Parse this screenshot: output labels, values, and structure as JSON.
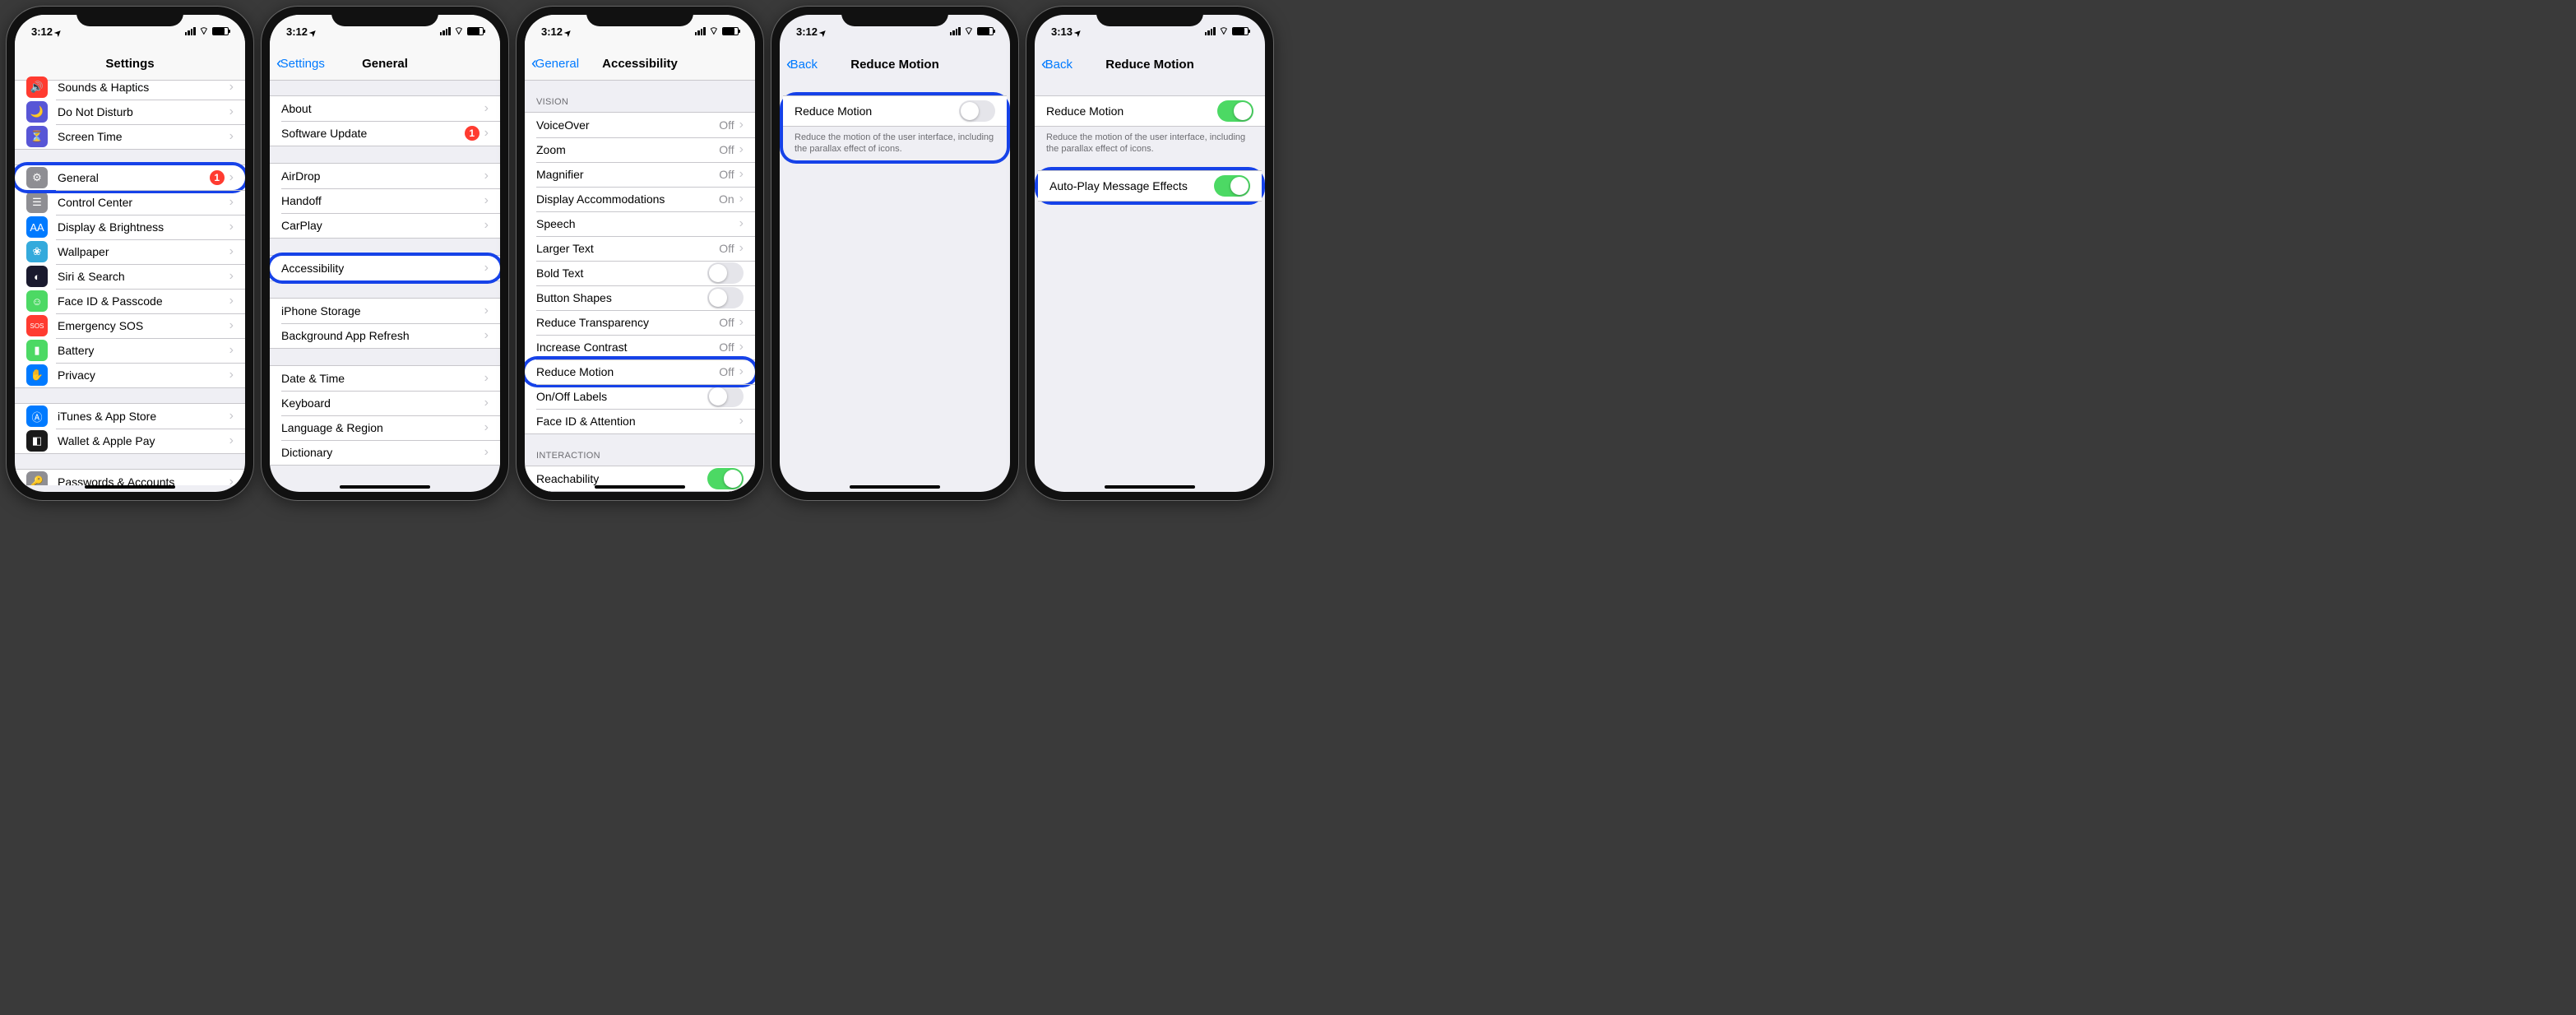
{
  "screens": [
    {
      "time": "3:12",
      "title": "Settings",
      "back": null,
      "groups": [
        {
          "items": [
            {
              "icon_bg": "#ff3b30",
              "icon": "🔊",
              "label": "Sounds & Haptics"
            },
            {
              "icon_bg": "#5856d6",
              "icon": "🌙",
              "label": "Do Not Disturb"
            },
            {
              "icon_bg": "#5856d6",
              "icon": "⏳",
              "label": "Screen Time"
            }
          ]
        },
        {
          "items": [
            {
              "icon_bg": "#8e8e93",
              "icon": "⚙",
              "label": "General",
              "badge": "1",
              "highlight": true
            },
            {
              "icon_bg": "#8e8e93",
              "icon": "☰",
              "label": "Control Center"
            },
            {
              "icon_bg": "#007aff",
              "icon": "AA",
              "label": "Display & Brightness"
            },
            {
              "icon_bg": "#34aadc",
              "icon": "❀",
              "label": "Wallpaper"
            },
            {
              "icon_bg": "#1a1a2e",
              "icon": "◐",
              "label": "Siri & Search"
            },
            {
              "icon_bg": "#4cd964",
              "icon": "☺",
              "label": "Face ID & Passcode"
            },
            {
              "icon_bg": "#ff3b30",
              "icon": "SOS",
              "label": "Emergency SOS"
            },
            {
              "icon_bg": "#4cd964",
              "icon": "▮",
              "label": "Battery"
            },
            {
              "icon_bg": "#007aff",
              "icon": "✋",
              "label": "Privacy"
            }
          ]
        },
        {
          "items": [
            {
              "icon_bg": "#007aff",
              "icon": "Ⓐ",
              "label": "iTunes & App Store"
            },
            {
              "icon_bg": "#1a1a1a",
              "icon": "◧",
              "label": "Wallet & Apple Pay"
            }
          ]
        },
        {
          "items": [
            {
              "icon_bg": "#8e8e93",
              "icon": "🔑",
              "label": "Passwords & Accounts"
            }
          ]
        }
      ]
    },
    {
      "time": "3:12",
      "title": "General",
      "back": "Settings",
      "groups": [
        {
          "items": [
            {
              "label": "About"
            },
            {
              "label": "Software Update",
              "badge": "1"
            }
          ]
        },
        {
          "items": [
            {
              "label": "AirDrop"
            },
            {
              "label": "Handoff"
            },
            {
              "label": "CarPlay"
            }
          ]
        },
        {
          "items": [
            {
              "label": "Accessibility",
              "highlight": true
            }
          ]
        },
        {
          "items": [
            {
              "label": "iPhone Storage"
            },
            {
              "label": "Background App Refresh"
            }
          ]
        },
        {
          "items": [
            {
              "label": "Date & Time"
            },
            {
              "label": "Keyboard"
            },
            {
              "label": "Language & Region"
            },
            {
              "label": "Dictionary"
            }
          ]
        }
      ]
    },
    {
      "time": "3:12",
      "title": "Accessibility",
      "back": "General",
      "sections": [
        {
          "header": "VISION",
          "items": [
            {
              "label": "VoiceOver",
              "detail": "Off"
            },
            {
              "label": "Zoom",
              "detail": "Off"
            },
            {
              "label": "Magnifier",
              "detail": "Off"
            },
            {
              "label": "Display Accommodations",
              "detail": "On"
            },
            {
              "label": "Speech"
            },
            {
              "label": "Larger Text",
              "detail": "Off"
            },
            {
              "label": "Bold Text",
              "switch": false
            },
            {
              "label": "Button Shapes",
              "switch": false
            },
            {
              "label": "Reduce Transparency",
              "detail": "Off"
            },
            {
              "label": "Increase Contrast",
              "detail": "Off"
            },
            {
              "label": "Reduce Motion",
              "detail": "Off",
              "highlight": true
            },
            {
              "label": "On/Off Labels",
              "switch": false
            },
            {
              "label": "Face ID & Attention"
            }
          ]
        },
        {
          "header": "INTERACTION",
          "items": [
            {
              "label": "Reachability",
              "switch": true
            }
          ]
        }
      ]
    },
    {
      "time": "3:12",
      "title": "Reduce Motion",
      "back": "Back",
      "rows": [
        {
          "label": "Reduce Motion",
          "switch": false,
          "highlight_group": true
        }
      ],
      "footer": "Reduce the motion of the user interface, including the parallax effect of icons."
    },
    {
      "time": "3:13",
      "title": "Reduce Motion",
      "back": "Back",
      "rows": [
        {
          "label": "Reduce Motion",
          "switch": true
        }
      ],
      "footer": "Reduce the motion of the user interface, including the parallax effect of icons.",
      "rows2": [
        {
          "label": "Auto-Play Message Effects",
          "switch": true,
          "highlight_group": true
        }
      ]
    }
  ]
}
